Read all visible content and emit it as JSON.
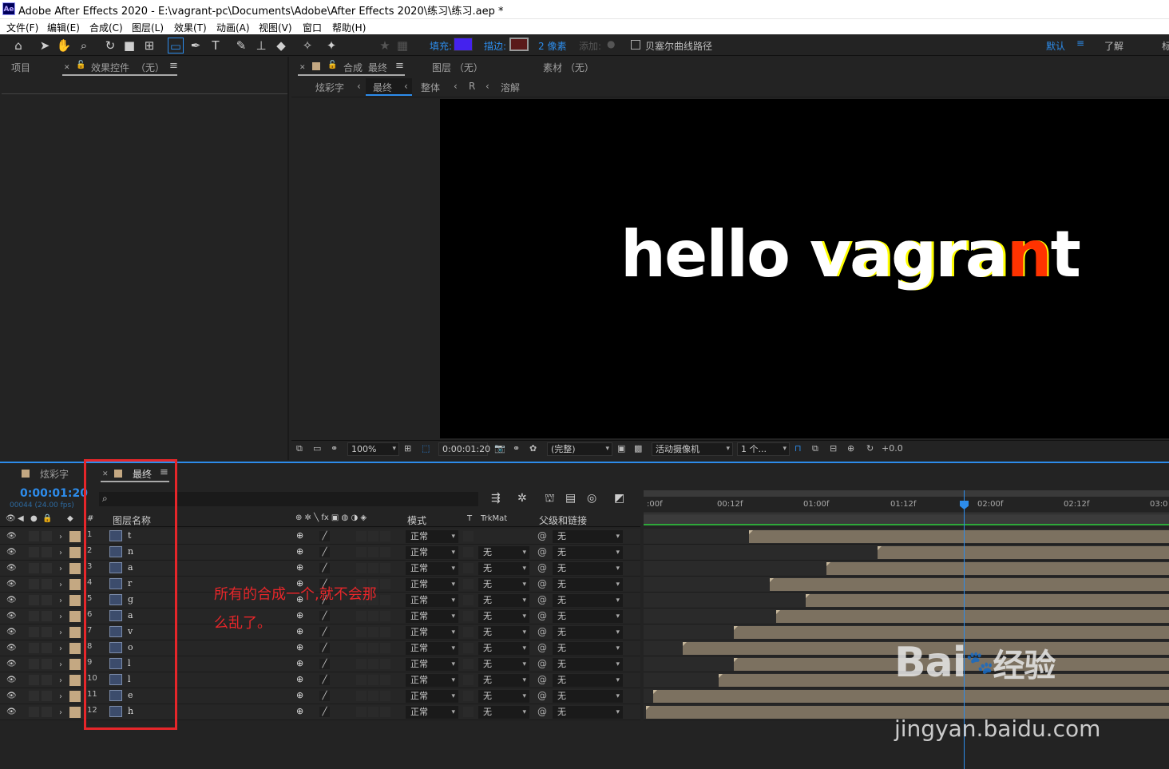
{
  "titlebar": {
    "app_icon": "Ae",
    "title": "Adobe After Effects 2020 - E:\\vagrant-pc\\Documents\\Adobe\\After Effects 2020\\练习\\练习.aep *"
  },
  "menu": [
    "文件(F)",
    "编辑(E)",
    "合成(C)",
    "图层(L)",
    "效果(T)",
    "动画(A)",
    "视图(V)",
    "窗口",
    "帮助(H)"
  ],
  "toolbar": {
    "fill_label": "填充:",
    "fill_color": "#4422ee",
    "stroke_label": "描边:",
    "stroke_px": "2 像素",
    "add_label": "添加:",
    "bezier_label": "贝塞尔曲线路径",
    "workspace_default": "默认",
    "workspace_learn": "了解",
    "workspace_more": "标"
  },
  "left_panel": {
    "project_tab": "项目",
    "effects_tab": "效果控件",
    "effects_tab_suffix": "（无）"
  },
  "comp_panel": {
    "tab_prefix": "合成",
    "tab_name": "最终",
    "layer_tab": "图层 （无）",
    "footage_tab": "素材 （无）",
    "breadcrumbs": [
      "炫彩字",
      "最终",
      "整体",
      "R",
      "溶解"
    ]
  },
  "viewer": {
    "text_white": "hello ",
    "text_v": "vagra",
    "text_glitch": "n",
    "text_end": "t"
  },
  "viewer_bar": {
    "zoom": "100%",
    "timecode": "0:00:01:20",
    "resolution": "(完整)",
    "camera": "活动摄像机",
    "views": "1 个...",
    "exposure": "+0.0"
  },
  "timeline": {
    "tabs": [
      "炫彩字",
      "最终"
    ],
    "current_time": "0:00:01:20",
    "frame_info": "00044 (24.00 fps)",
    "search_placeholder": "",
    "col_layer_name": "图层名称",
    "col_mode": "模式",
    "col_t": "T",
    "col_trkmat": "TrkMat",
    "col_parent": "父级和链接",
    "ruler": [
      ":00f",
      "00:12f",
      "01:00f",
      "01:12f",
      "02:00f",
      "02:12f",
      "03:0"
    ],
    "layers": [
      {
        "num": "1",
        "name": "t",
        "mode": "正常",
        "trkmat": "",
        "parent": "无",
        "start": 0.2
      },
      {
        "num": "2",
        "name": "n",
        "mode": "正常",
        "trkmat": "无",
        "parent": "无",
        "start": 0.445
      },
      {
        "num": "3",
        "name": "a",
        "mode": "正常",
        "trkmat": "无",
        "parent": "无",
        "start": 0.348
      },
      {
        "num": "4",
        "name": "r",
        "mode": "正常",
        "trkmat": "无",
        "parent": "无",
        "start": 0.24
      },
      {
        "num": "5",
        "name": "g",
        "mode": "正常",
        "trkmat": "无",
        "parent": "无",
        "start": 0.308
      },
      {
        "num": "6",
        "name": "a",
        "mode": "正常",
        "trkmat": "无",
        "parent": "无",
        "start": 0.252
      },
      {
        "num": "7",
        "name": "v",
        "mode": "正常",
        "trkmat": "无",
        "parent": "无",
        "start": 0.172
      },
      {
        "num": "8",
        "name": "o",
        "mode": "正常",
        "trkmat": "无",
        "parent": "无",
        "start": 0.074
      },
      {
        "num": "9",
        "name": "l",
        "mode": "正常",
        "trkmat": "无",
        "parent": "无",
        "start": 0.172
      },
      {
        "num": "10",
        "name": "l",
        "mode": "正常",
        "trkmat": "无",
        "parent": "无",
        "start": 0.143
      },
      {
        "num": "11",
        "name": "e",
        "mode": "正常",
        "trkmat": "无",
        "parent": "无",
        "start": 0.018
      },
      {
        "num": "12",
        "name": "h",
        "mode": "正常",
        "trkmat": "无",
        "parent": "无",
        "start": 0.005
      }
    ]
  },
  "annotation": {
    "text": "所有的合成一个,就不会那么乱了。"
  },
  "watermark": {
    "logo": "Bai",
    "logo_suffix": "经验",
    "url": "jingyan.baidu.com"
  }
}
